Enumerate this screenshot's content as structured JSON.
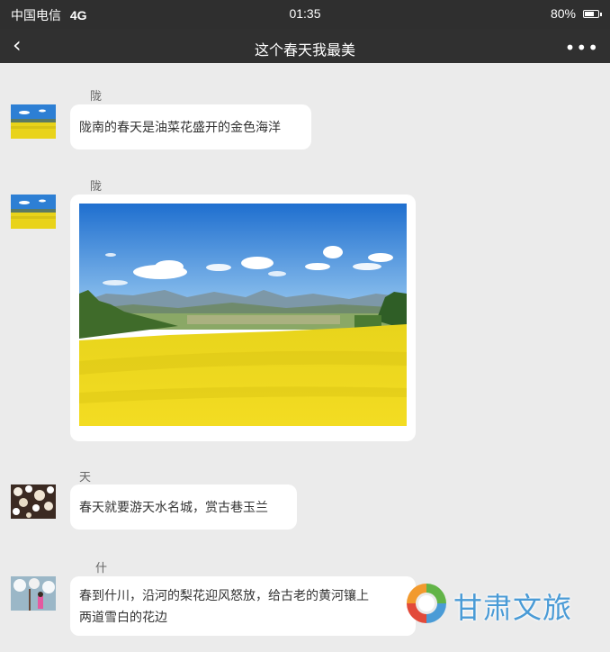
{
  "status_bar": {
    "carrier": "中国电信",
    "network": "4G",
    "time": "01:35",
    "battery": "80%",
    "battery_level": 0.8
  },
  "nav": {
    "back_icon": "chevron-left-icon",
    "title": "这个春天我最美",
    "more_icon": "more-dots-icon"
  },
  "messages": [
    {
      "sender": "陇南",
      "text": "陇南的春天是油菜花盛开的金色海洋"
    },
    {
      "sender": "陇南",
      "image": "rapeseed-field-photo"
    },
    {
      "sender": "天水",
      "text": "春天就要游天水名城，赏古巷玉兰"
    },
    {
      "sender": "什川",
      "text_line1": "春到什川，沿河的梨花迎风怒放，给古老的黄河镶上",
      "text_line2": "两道雪白的花边"
    }
  ],
  "watermark": {
    "text": "甘肃文旅",
    "colors": {
      "red": "#e24a3a",
      "orange": "#f29a2e",
      "green": "#62b447",
      "blue": "#4a9bd6"
    }
  },
  "colors": {
    "status_bar_bg": "#2f2f2f",
    "chat_bg": "#ebebeb",
    "bubble_bg": "#ffffff",
    "rapeseed_yellow": "#f1d81b",
    "sky_blue": "#2c7cd1"
  }
}
